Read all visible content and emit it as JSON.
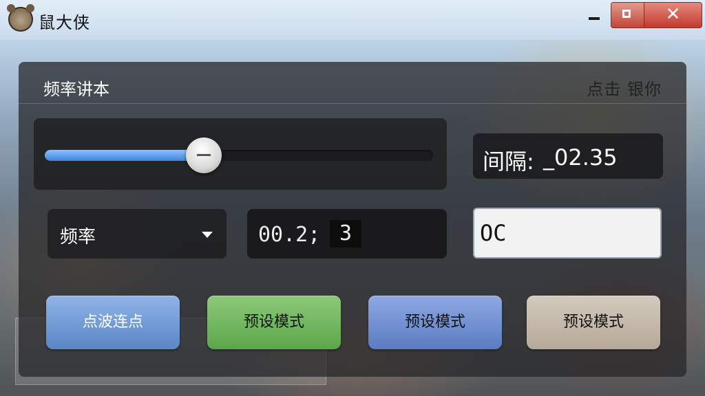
{
  "window": {
    "title": "鼠大侠",
    "close_glyph": "✕"
  },
  "panel": {
    "title": "频率讲本",
    "right_text": "点击 银你"
  },
  "slider": {
    "level_fraction": 0.41
  },
  "interval": {
    "label": "间隔:",
    "value": "_02.35"
  },
  "select": {
    "selected": "频率"
  },
  "value_field": {
    "part_a": "00.2;",
    "part_b": "3"
  },
  "text_input": {
    "value": "OC"
  },
  "buttons": [
    {
      "label": "点波连点"
    },
    {
      "label": "预设模式"
    },
    {
      "label": "预设模式"
    },
    {
      "label": "预设模式"
    }
  ],
  "icons": {
    "app": "mouse-avatar-icon",
    "minimize": "minimize-icon",
    "maximize": "maximize-icon",
    "close": "close-icon",
    "dropdown": "chevron-down-icon"
  }
}
